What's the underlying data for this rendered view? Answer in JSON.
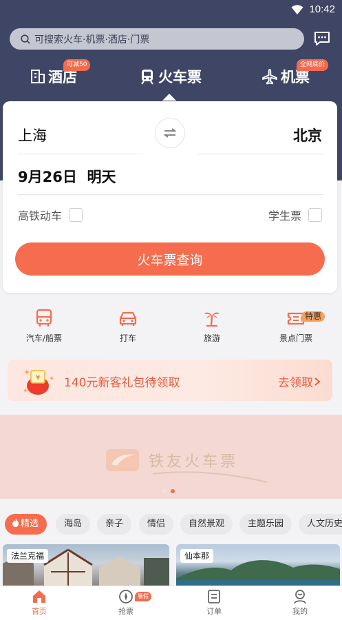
{
  "status_bar": {
    "time": "10:42"
  },
  "search": {
    "placeholder": "可搜索火车·机票·酒店·门票"
  },
  "tabs": [
    {
      "label": "酒店",
      "badge": "可减50"
    },
    {
      "label": "火车票"
    },
    {
      "label": "机票",
      "badge": "全网底价"
    }
  ],
  "booking": {
    "from_city": "上海",
    "to_city": "北京",
    "date": "9月26日",
    "day": "明天",
    "option_high_speed": "高铁动车",
    "option_student": "学生票",
    "search_button": "火车票查询"
  },
  "shortcuts": [
    {
      "label": "汽车/船票",
      "icon": "bus-icon"
    },
    {
      "label": "打车",
      "icon": "taxi-icon"
    },
    {
      "label": "旅游",
      "icon": "palm-tree-icon"
    },
    {
      "label": "景点门票",
      "icon": "ticket-icon",
      "badge": "特惠"
    }
  ],
  "promo": {
    "text": "140元新客礼包待领取",
    "link": "去领取"
  },
  "banner": {
    "text": "铁友火车票"
  },
  "filters": [
    "精选",
    "海岛",
    "亲子",
    "情侣",
    "自然景观",
    "主题乐园",
    "人文历史"
  ],
  "destinations": [
    {
      "label": "法兰克福"
    },
    {
      "label": "仙本那"
    }
  ],
  "bottom_nav": [
    {
      "label": "首页"
    },
    {
      "label": "抢票",
      "badge": "暑假"
    },
    {
      "label": "订单"
    },
    {
      "label": "我的"
    }
  ],
  "colors": {
    "header": "#3f4665",
    "accent": "#f56d4e"
  }
}
